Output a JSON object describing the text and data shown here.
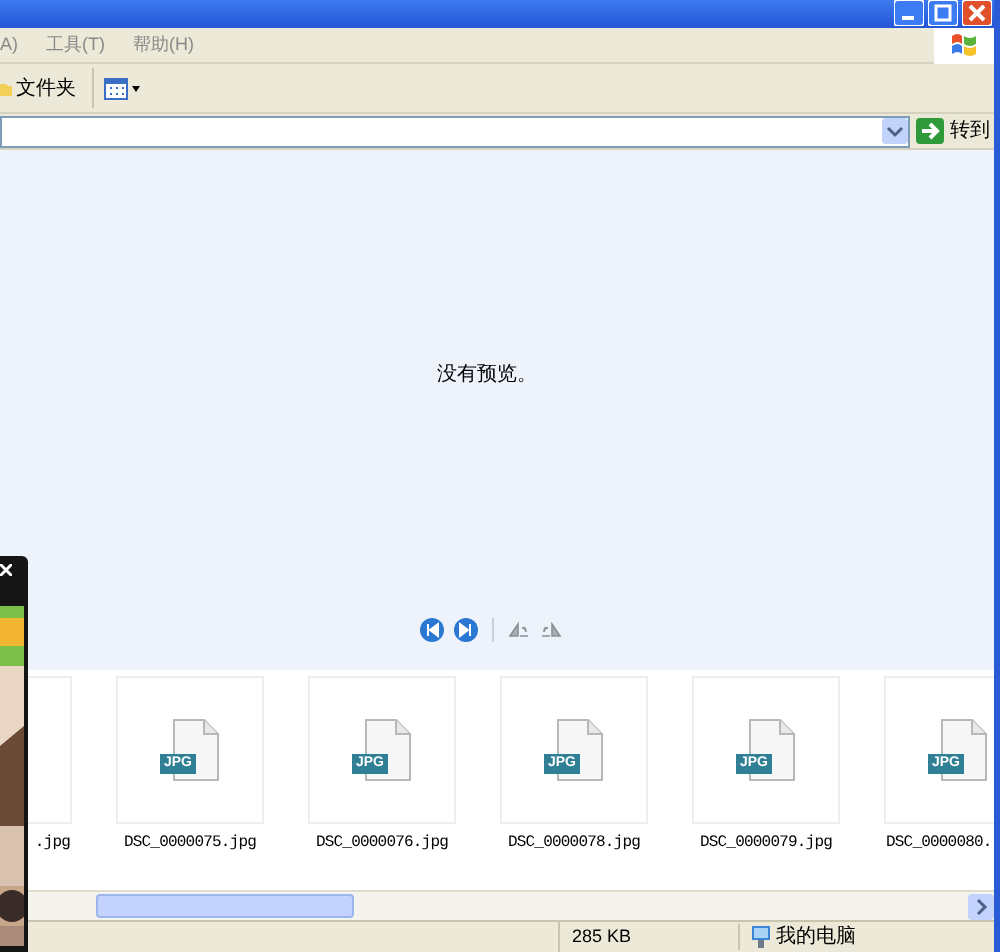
{
  "menu": [
    "A)",
    "工具(T)",
    "帮助(H)"
  ],
  "toolbar": {
    "folders_label": "文件夹"
  },
  "address_bar": {
    "go_label": "转到"
  },
  "preview": {
    "message": "没有预览。"
  },
  "filmstrip": {
    "items": [
      {
        "label": ".jpg"
      },
      {
        "badge": "JPG",
        "label": "DSC_0000075.jpg"
      },
      {
        "badge": "JPG",
        "label": "DSC_0000076.jpg"
      },
      {
        "badge": "JPG",
        "label": "DSC_0000078.jpg"
      },
      {
        "badge": "JPG",
        "label": "DSC_0000079.jpg"
      },
      {
        "badge": "JPG",
        "label": "DSC_0000080."
      }
    ]
  },
  "status_bar": {
    "size": "285 KB",
    "location": "我的电脑"
  }
}
